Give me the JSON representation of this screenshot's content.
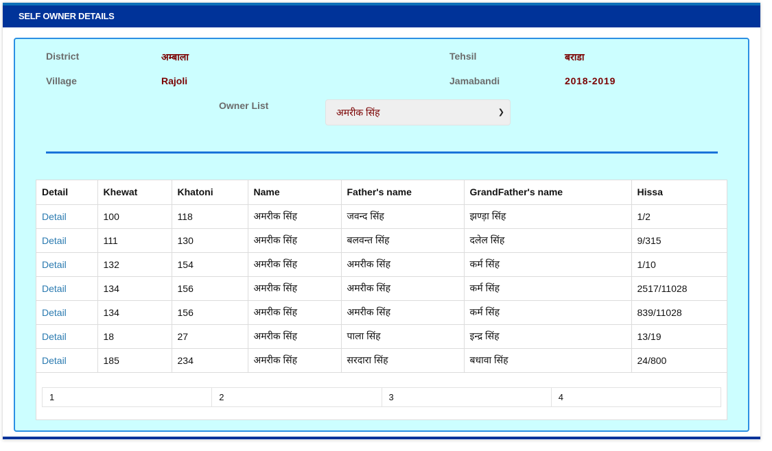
{
  "header": {
    "title": "SELF OWNER DETAILS"
  },
  "info": {
    "district_label": "District",
    "district_value": "अम्बाला",
    "tehsil_label": "Tehsil",
    "tehsil_value": "बराडा",
    "village_label": "Village",
    "village_value": "Rajoli",
    "jamabandi_label": "Jamabandi",
    "jamabandi_value": "2018-2019"
  },
  "owner_list": {
    "label": "Owner List",
    "selected": "अमरीक सिंह"
  },
  "table": {
    "headers": [
      "Detail",
      "Khewat",
      "Khatoni",
      "Name",
      "Father's name",
      "GrandFather's name",
      "Hissa"
    ],
    "rows": [
      [
        "Detail",
        "100",
        "118",
        "अमरीक सिंह",
        "जवन्द सिंह",
        "झण्ड़ा सिंह",
        "1/2"
      ],
      [
        "Detail",
        "111",
        "130",
        "अमरीक सिंह",
        "बलवन्त सिंह",
        "दलेल सिंह",
        "9/315"
      ],
      [
        "Detail",
        "132",
        "154",
        "अमरीक सिंह",
        "अमरीक सिंह",
        "कर्म सिंह",
        "1/10"
      ],
      [
        "Detail",
        "134",
        "156",
        "अमरीक सिंह",
        "अमरीक सिंह",
        "कर्म सिंह",
        "2517/11028"
      ],
      [
        "Detail",
        "134",
        "156",
        "अमरीक सिंह",
        "अमरीक सिंह",
        "कर्म सिंह",
        "839/11028"
      ],
      [
        "Detail",
        "18",
        "27",
        "अमरीक सिंह",
        "पाला सिंह",
        "इन्द्र सिंह",
        "13/19"
      ],
      [
        "Detail",
        "185",
        "234",
        "अमरीक सिंह",
        "सरदारा सिंह",
        "बधावा सिंह",
        "24/800"
      ]
    ]
  },
  "pager": {
    "pages": [
      "1",
      "2",
      "3",
      "4"
    ]
  },
  "colors": {
    "header_bg": "#003399",
    "panel_bg": "#ccfeff",
    "value_text": "#7a0000",
    "link": "#2a7ab0"
  }
}
